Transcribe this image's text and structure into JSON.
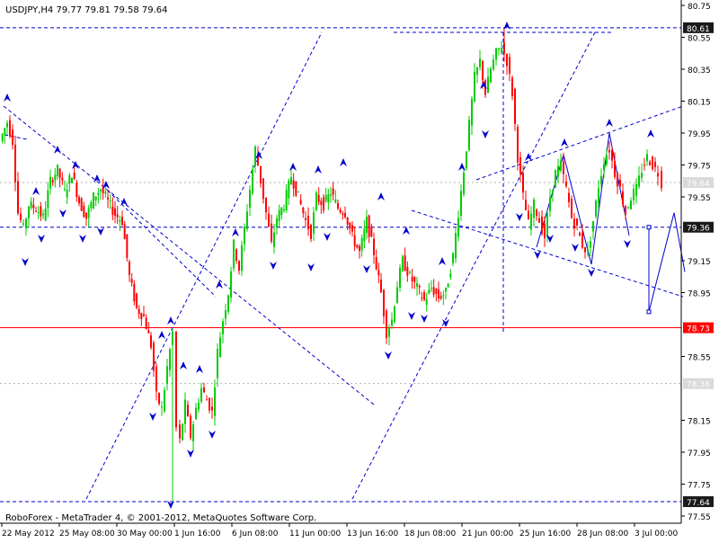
{
  "window": {
    "symbol_header": "USDJPY,H4  79.77 79.81 79.58 79.64",
    "footer": "RoboForex - MetaTrader 4, © 2001-2012, MetaQuotes Software Corp."
  },
  "colors": {
    "background": "#ffffff",
    "bull": "#00cc00",
    "bear": "#ff0000",
    "analysis_line": "#0000cc",
    "support_line": "#ff0000",
    "axis_text": "#000000"
  },
  "chart_data": {
    "type": "candlestick",
    "symbol": "USDJPY",
    "timeframe": "H4",
    "ohlc_readout": {
      "open": 79.77,
      "high": 79.81,
      "low": 79.58,
      "close": 79.64
    },
    "ylim": [
      77.55,
      80.75
    ],
    "y_ticks": [
      80.75,
      80.55,
      80.35,
      80.15,
      79.95,
      79.75,
      79.55,
      79.15,
      78.95,
      78.55,
      78.15,
      77.95,
      77.75,
      77.55
    ],
    "x_ticks": [
      "22 May 2012",
      "25 May 08:00",
      "30 May 00:00",
      "1 Jun 16:00",
      "6 Jun 08:00",
      "11 Jun 00:00",
      "13 Jun 16:00",
      "18 Jun 08:00",
      "21 Jun 00:00",
      "25 Jun 16:00",
      "28 Jun 08:00",
      "3 Jul 00:00"
    ],
    "price_labels": [
      {
        "value": 80.61,
        "text": "80.61",
        "style": "dark"
      },
      {
        "value": 79.64,
        "text": "79.64",
        "style": "light"
      },
      {
        "value": 79.36,
        "text": "79.36",
        "style": "dark"
      },
      {
        "value": 78.73,
        "text": "78.73",
        "style": "red"
      },
      {
        "value": 78.38,
        "text": "78.38",
        "style": "light"
      },
      {
        "value": 77.64,
        "text": "77.64",
        "style": "dark"
      }
    ],
    "horizontal_levels": [
      {
        "value": 80.61,
        "style": "dashed-blue"
      },
      {
        "value": 79.64,
        "style": "dotted-gray"
      },
      {
        "value": 79.36,
        "style": "dashed-blue"
      },
      {
        "value": 78.73,
        "style": "solid-red"
      },
      {
        "value": 78.38,
        "style": "dotted-gray"
      },
      {
        "value": 77.64,
        "style": "dashed-blue"
      }
    ],
    "price_path": [
      [
        0,
        79.9
      ],
      [
        8,
        80.02
      ],
      [
        14,
        79.9
      ],
      [
        20,
        79.45
      ],
      [
        26,
        79.35
      ],
      [
        32,
        79.5
      ],
      [
        40,
        79.48
      ],
      [
        48,
        79.42
      ],
      [
        56,
        79.65
      ],
      [
        64,
        79.72
      ],
      [
        72,
        79.58
      ],
      [
        80,
        79.7
      ],
      [
        88,
        79.52
      ],
      [
        96,
        79.42
      ],
      [
        104,
        79.55
      ],
      [
        112,
        79.6
      ],
      [
        120,
        79.52
      ],
      [
        128,
        79.44
      ],
      [
        136,
        79.4
      ],
      [
        144,
        79.05
      ],
      [
        152,
        78.85
      ],
      [
        160,
        78.8
      ],
      [
        168,
        78.62
      ],
      [
        174,
        78.3
      ],
      [
        180,
        78.22
      ],
      [
        186,
        78.48
      ],
      [
        192,
        78.7
      ],
      [
        196,
        78.1
      ],
      [
        200,
        78.02
      ],
      [
        206,
        78.25
      ],
      [
        212,
        78.05
      ],
      [
        218,
        78.22
      ],
      [
        224,
        78.35
      ],
      [
        230,
        78.28
      ],
      [
        236,
        78.2
      ],
      [
        242,
        78.58
      ],
      [
        248,
        78.78
      ],
      [
        254,
        78.95
      ],
      [
        260,
        79.25
      ],
      [
        266,
        79.1
      ],
      [
        272,
        79.35
      ],
      [
        278,
        79.6
      ],
      [
        284,
        79.85
      ],
      [
        290,
        79.65
      ],
      [
        296,
        79.45
      ],
      [
        302,
        79.25
      ],
      [
        308,
        79.42
      ],
      [
        316,
        79.5
      ],
      [
        324,
        79.68
      ],
      [
        332,
        79.55
      ],
      [
        340,
        79.4
      ],
      [
        346,
        79.32
      ],
      [
        352,
        79.55
      ],
      [
        360,
        79.5
      ],
      [
        368,
        79.58
      ],
      [
        376,
        79.48
      ],
      [
        384,
        79.45
      ],
      [
        392,
        79.3
      ],
      [
        400,
        79.2
      ],
      [
        408,
        79.4
      ],
      [
        416,
        79.2
      ],
      [
        424,
        78.95
      ],
      [
        430,
        78.7
      ],
      [
        436,
        78.78
      ],
      [
        442,
        79.0
      ],
      [
        448,
        79.15
      ],
      [
        456,
        79.05
      ],
      [
        464,
        78.98
      ],
      [
        472,
        78.9
      ],
      [
        480,
        78.98
      ],
      [
        488,
        78.92
      ],
      [
        496,
        78.95
      ],
      [
        504,
        79.18
      ],
      [
        510,
        79.45
      ],
      [
        516,
        79.72
      ],
      [
        522,
        80.0
      ],
      [
        528,
        80.3
      ],
      [
        534,
        80.4
      ],
      [
        540,
        80.2
      ],
      [
        546,
        80.35
      ],
      [
        552,
        80.45
      ],
      [
        558,
        80.5
      ],
      [
        564,
        80.4
      ],
      [
        570,
        80.2
      ],
      [
        576,
        79.8
      ],
      [
        582,
        79.55
      ],
      [
        588,
        79.38
      ],
      [
        594,
        79.5
      ],
      [
        600,
        79.4
      ],
      [
        606,
        79.3
      ],
      [
        612,
        79.55
      ],
      [
        618,
        79.7
      ],
      [
        624,
        79.75
      ],
      [
        630,
        79.6
      ],
      [
        636,
        79.42
      ],
      [
        642,
        79.35
      ],
      [
        648,
        79.25
      ],
      [
        654,
        79.2
      ],
      [
        660,
        79.4
      ],
      [
        666,
        79.62
      ],
      [
        672,
        79.78
      ],
      [
        678,
        79.85
      ],
      [
        684,
        79.7
      ],
      [
        690,
        79.6
      ],
      [
        696,
        79.45
      ],
      [
        702,
        79.55
      ],
      [
        708,
        79.6
      ],
      [
        714,
        79.72
      ],
      [
        720,
        79.8
      ],
      [
        726,
        79.75
      ],
      [
        732,
        79.7
      ],
      [
        736,
        79.64
      ]
    ],
    "forecast": [
      {
        "from": [
          722,
          79.36
        ],
        "to": [
          722,
          78.83
        ]
      },
      {
        "from": [
          722,
          78.83
        ],
        "to": [
          750,
          79.45
        ]
      },
      {
        "from": [
          750,
          79.45
        ],
        "to": [
          762,
          79.08
        ]
      }
    ]
  }
}
